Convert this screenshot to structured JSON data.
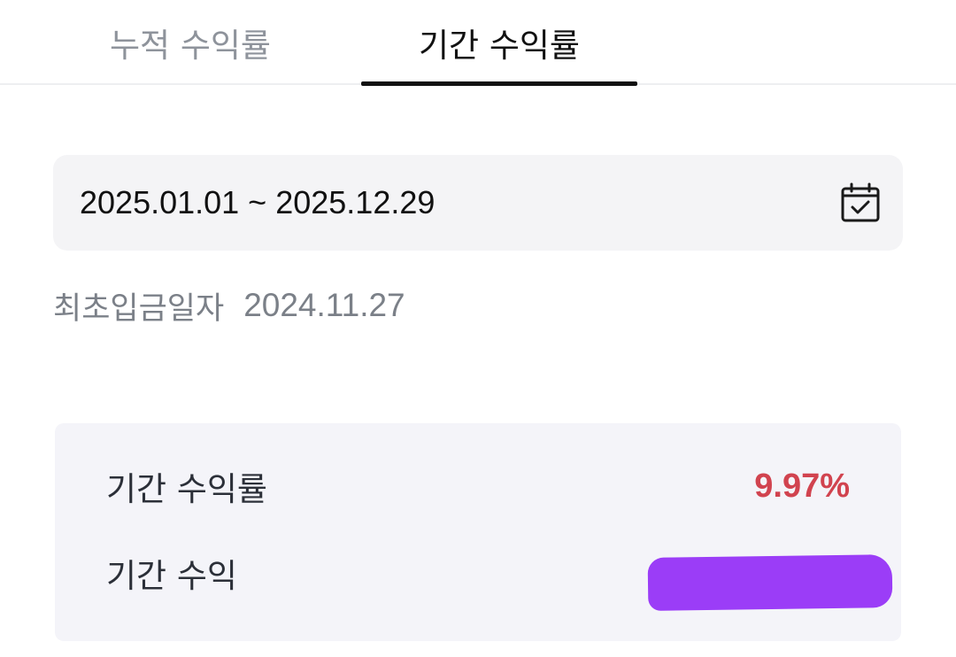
{
  "tabs": [
    {
      "label": "누적 수익률",
      "active": false
    },
    {
      "label": "기간 수익률",
      "active": true
    }
  ],
  "date_range": {
    "value": "2025.01.01 ~ 2025.12.29",
    "icon": "calendar-check-icon"
  },
  "first_deposit": {
    "label": "최초입금일자",
    "value": "2024.11.27"
  },
  "summary": {
    "rate_label": "기간 수익률",
    "rate_value": "9.97%",
    "profit_label": "기간 수익"
  },
  "colors": {
    "positive_rate": "#d1434f",
    "active_tab": "#111111",
    "inactive_tab": "#8e939b",
    "redaction": "#9b3df7"
  }
}
